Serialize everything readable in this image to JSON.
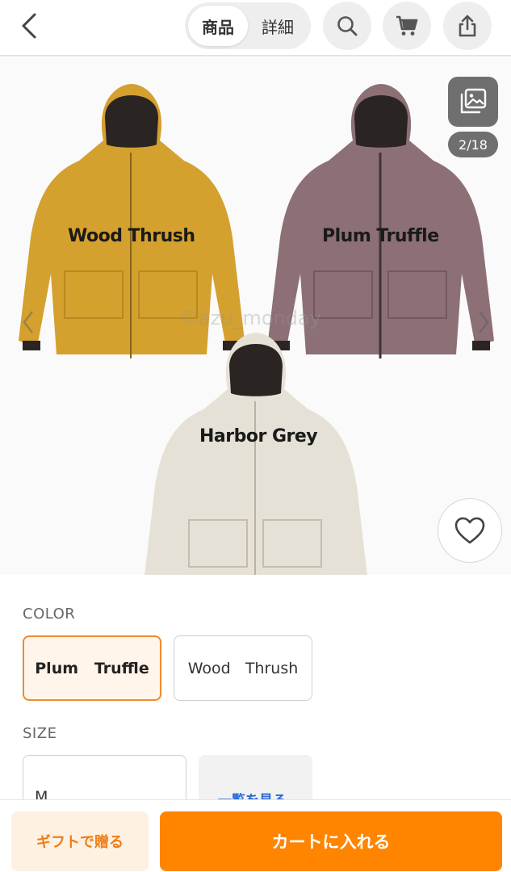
{
  "header": {
    "tabs": [
      {
        "label": "商品",
        "active": true
      },
      {
        "label": "詳細",
        "active": false
      }
    ],
    "icons": [
      "chevron-left-icon",
      "search-icon",
      "cart-icon",
      "share-icon"
    ]
  },
  "gallery": {
    "counter": "2/18",
    "watermark": "©azu_monday",
    "labels": {
      "wood": "Wood Thrush",
      "plum": "Plum Truffle",
      "grey": "Harbor Grey"
    },
    "colors": {
      "wood": "#d4a02e",
      "plum": "#8c7076",
      "grey": "#e6e1d6"
    }
  },
  "options": {
    "color_label": "COLOR",
    "colors": [
      {
        "label": "Plum   Truffle",
        "selected": true
      },
      {
        "label": "Wood   Thrush",
        "selected": false
      }
    ],
    "size_label": "SIZE",
    "size_value": "M",
    "list_link": "一覧を見る"
  },
  "actions": {
    "gift": "ギフトで贈る",
    "cart": "カートに入れる"
  },
  "theme": {
    "accent": "#ff8500",
    "accent_light": "#fff1e2",
    "link": "#2a6ad8"
  }
}
